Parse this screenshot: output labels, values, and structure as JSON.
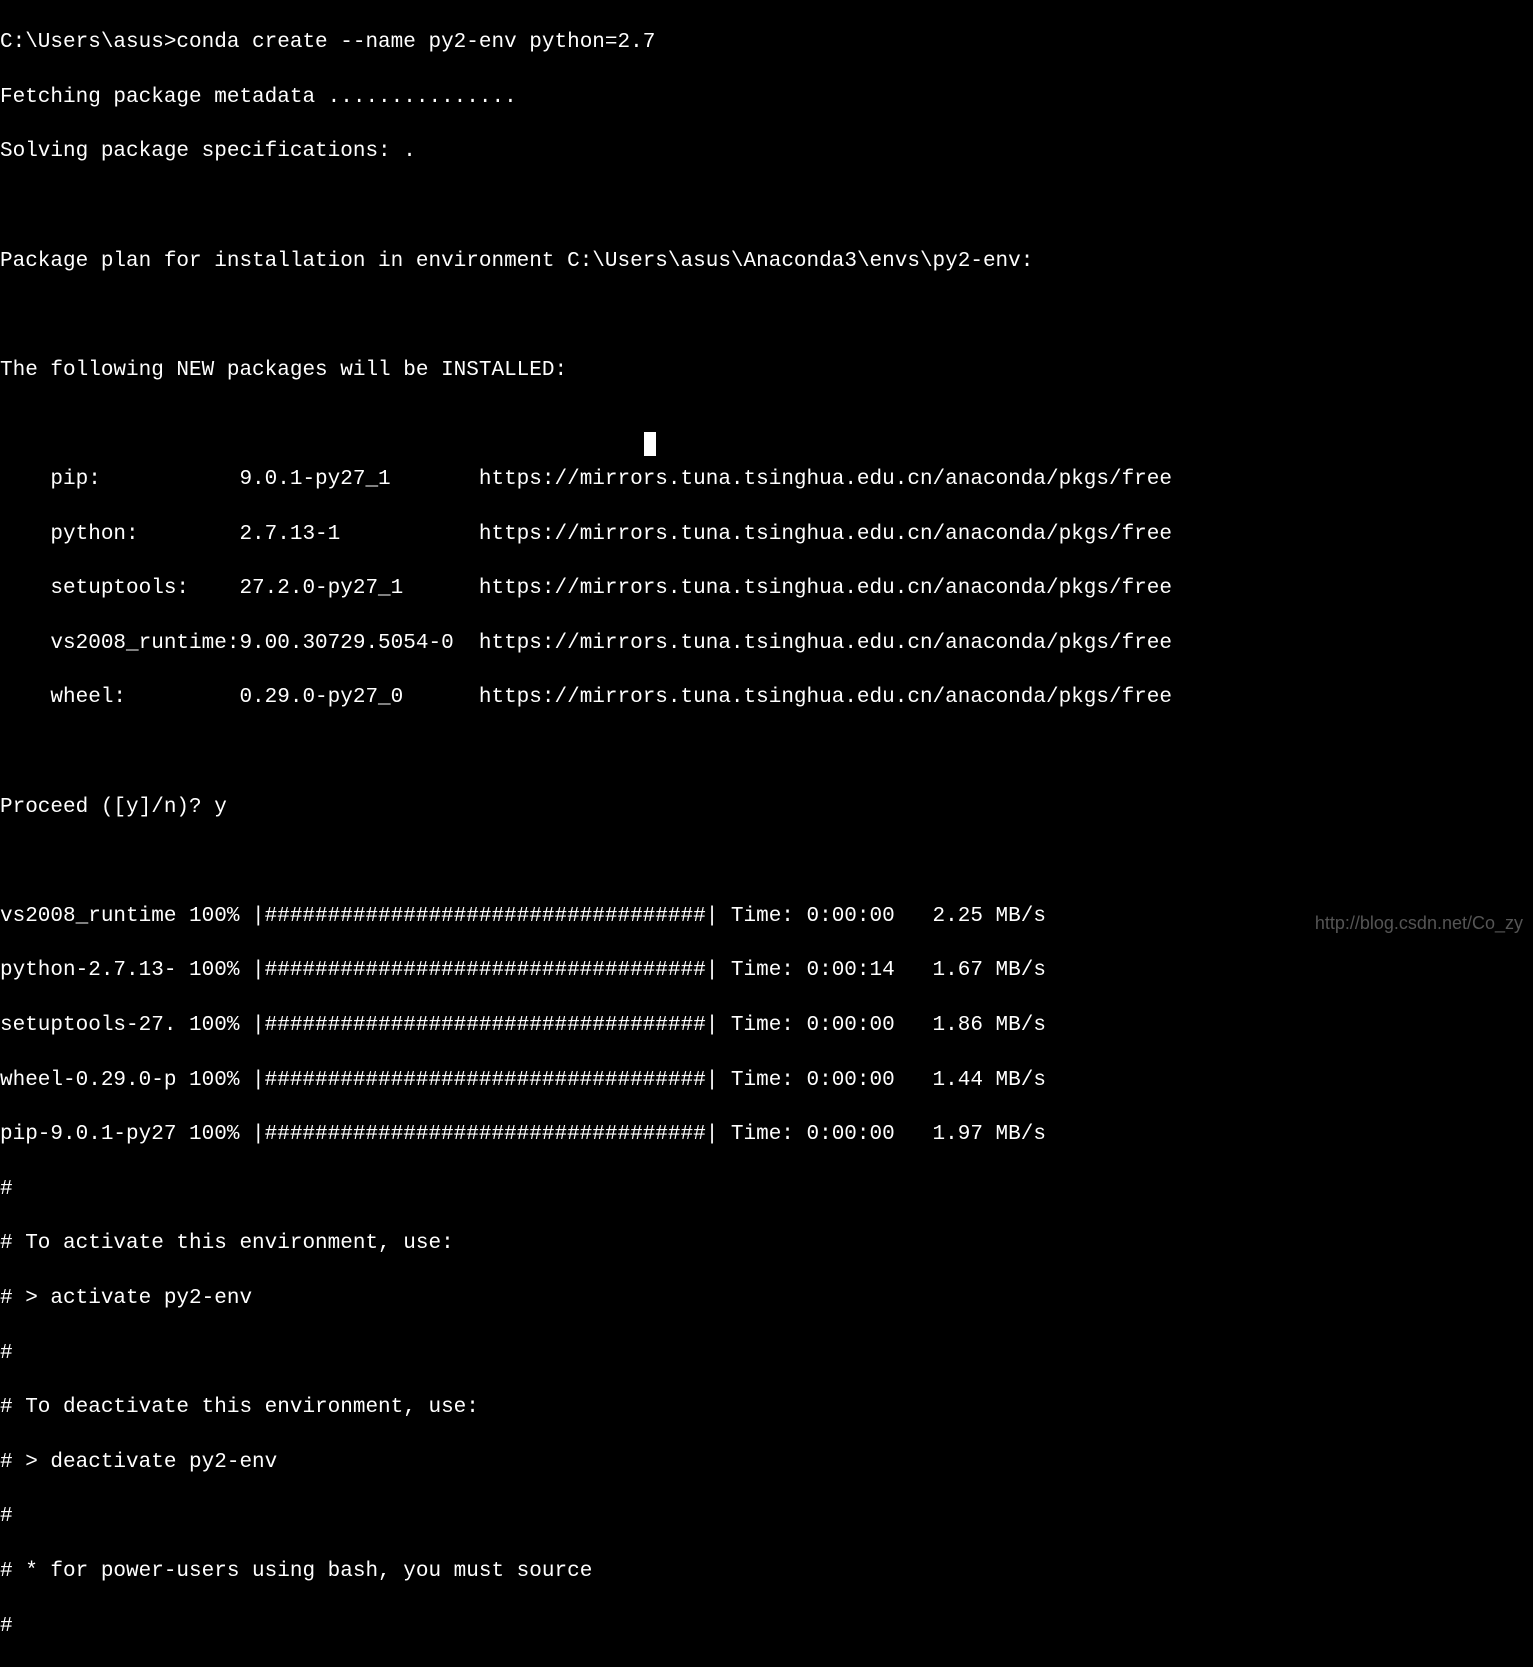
{
  "prompt_line": "C:\\Users\\asus>conda create --name py2-env python=2.7",
  "fetching": "Fetching package metadata ...............",
  "solving": "Solving package specifications: .",
  "plan_header": "Package plan for installation in environment C:\\Users\\asus\\Anaconda3\\envs\\py2-env:",
  "new_pkg_header": "The following NEW packages will be INSTALLED:",
  "packages": [
    {
      "name": "pip:",
      "version": "9.0.1-py27_1",
      "url": "https://mirrors.tuna.tsinghua.edu.cn/anaconda/pkgs/free"
    },
    {
      "name": "python:",
      "version": "2.7.13-1",
      "url": "https://mirrors.tuna.tsinghua.edu.cn/anaconda/pkgs/free"
    },
    {
      "name": "setuptools:",
      "version": "27.2.0-py27_1",
      "url": "https://mirrors.tuna.tsinghua.edu.cn/anaconda/pkgs/free"
    },
    {
      "name": "vs2008_runtime:",
      "version": "9.00.30729.5054-0",
      "url": "https://mirrors.tuna.tsinghua.edu.cn/anaconda/pkgs/free"
    },
    {
      "name": "wheel:",
      "version": "0.29.0-py27_0",
      "url": "https://mirrors.tuna.tsinghua.edu.cn/anaconda/pkgs/free"
    }
  ],
  "proceed": "Proceed ([y]/n)? y",
  "progress": [
    {
      "name": "vs2008_runtime",
      "pct": "100%",
      "bar": "|###################################|",
      "time": "Time: 0:00:00",
      "speed": "  2.25 MB/s"
    },
    {
      "name": "python-2.7.13-",
      "pct": "100%",
      "bar": "|###################################|",
      "time": "Time: 0:00:14",
      "speed": "  1.67 MB/s"
    },
    {
      "name": "setuptools-27.",
      "pct": "100%",
      "bar": "|###################################|",
      "time": "Time: 0:00:00",
      "speed": "  1.86 MB/s"
    },
    {
      "name": "wheel-0.29.0-p",
      "pct": "100%",
      "bar": "|###################################|",
      "time": "Time: 0:00:00",
      "speed": "  1.44 MB/s"
    },
    {
      "name": "pip-9.0.1-py27",
      "pct": "100%",
      "bar": "|###################################|",
      "time": "Time: 0:00:00",
      "speed": "  1.97 MB/s"
    }
  ],
  "footer": [
    "#",
    "# To activate this environment, use:",
    "# > activate py2-env",
    "#",
    "# To deactivate this environment, use:",
    "# > deactivate py2-env",
    "#",
    "# * for power-users using bash, you must source",
    "#"
  ],
  "watermark": "http://blog.csdn.net/Co_zy"
}
